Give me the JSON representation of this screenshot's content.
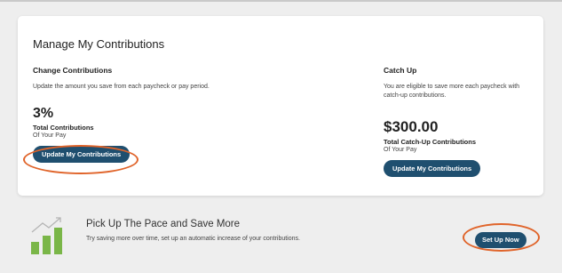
{
  "card": {
    "title": "Manage My Contributions",
    "change": {
      "heading": "Change Contributions",
      "description": "Update the amount you save from each paycheck or pay period.",
      "value": "3%",
      "value_label": "Total Contributions",
      "value_sub": "Of Your Pay",
      "button_label": "Update My Contributions"
    },
    "catchup": {
      "heading": "Catch Up",
      "description": "You are eligible to save more each paycheck with catch-up contributions.",
      "value": "$300.00",
      "value_label": "Total Catch-Up Contributions",
      "value_sub": "Of Your Pay",
      "button_label": "Update My Contributions"
    }
  },
  "promo": {
    "title": "Pick Up The Pace and Save More",
    "description": "Try saving more over time, set up an automatic increase of your contributions.",
    "button_label": "Set Up Now"
  },
  "colors": {
    "button": "#1f4f6f",
    "highlight_ring": "#e0642a",
    "growth_bars": "#7ab648"
  },
  "icons": [
    "growth-chart-icon"
  ]
}
